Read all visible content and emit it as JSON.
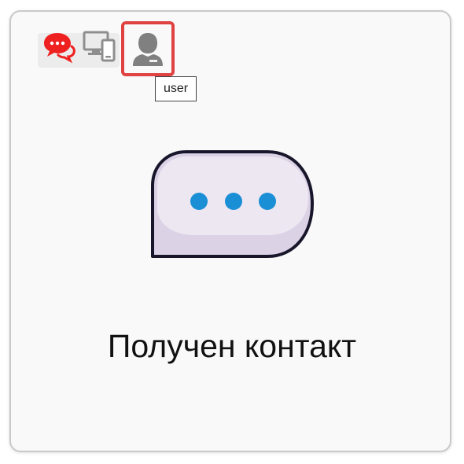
{
  "toolbar": {
    "buttons": [
      {
        "id": "chat",
        "icon": "chat-bubbles-icon",
        "color": "#ee2020"
      },
      {
        "id": "devices",
        "icon": "devices-icon",
        "color": "#8e8e8e"
      },
      {
        "id": "user",
        "icon": "user-icon",
        "color": "#808080",
        "selected": true
      }
    ],
    "tooltip": "user",
    "selected_border_color": "#e04242"
  },
  "main": {
    "illustration_icon": "typing-bubble-icon",
    "dot_color": "#1a8fd6",
    "caption": "Получен контакт"
  }
}
